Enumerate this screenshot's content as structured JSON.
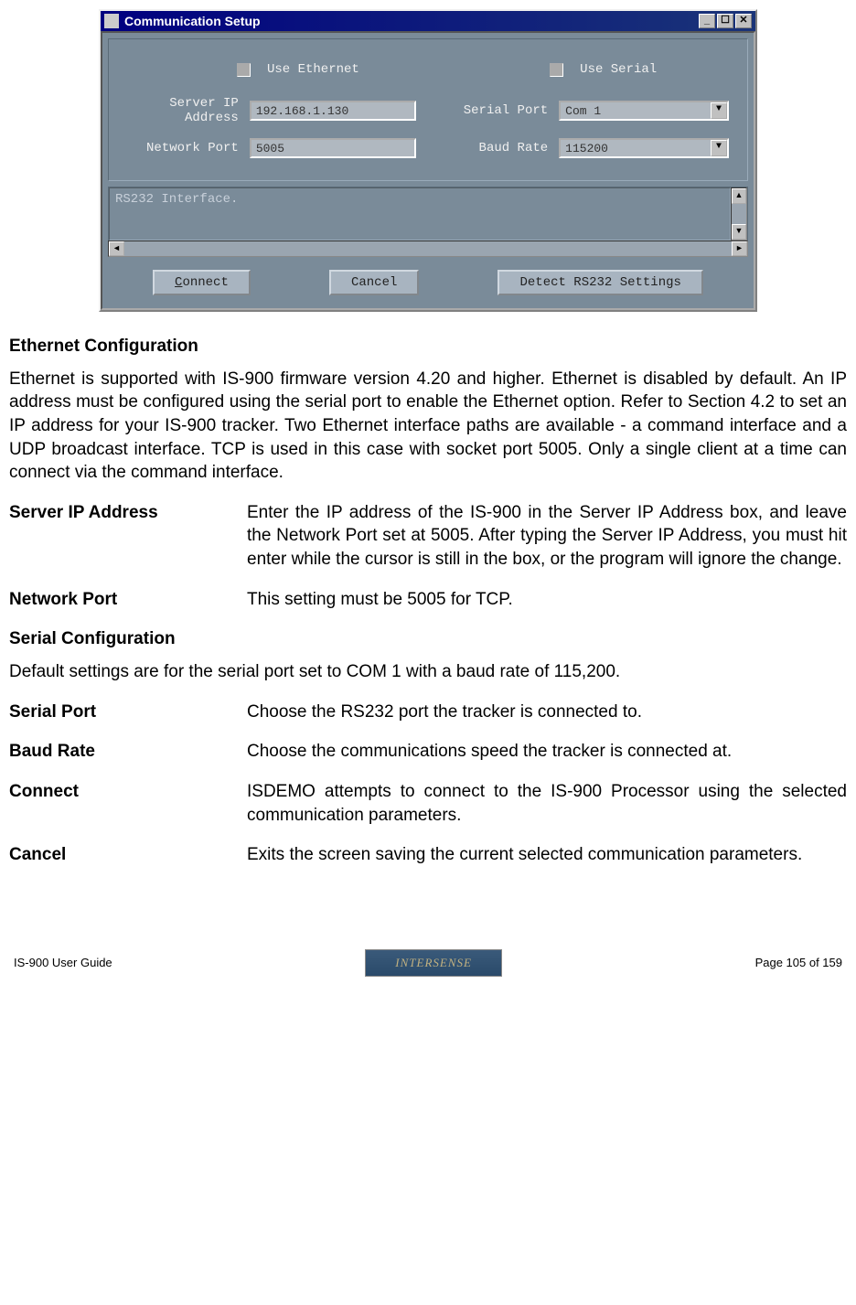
{
  "dialog": {
    "title": "Communication Setup",
    "use_ethernet_label": "Use Ethernet",
    "use_serial_label": "Use Serial",
    "server_ip_label": "Server IP Address",
    "server_ip_value": "192.168.1.130",
    "network_port_label": "Network Port",
    "network_port_value": "5005",
    "serial_port_label": "Serial Port",
    "serial_port_value": "Com 1",
    "baud_rate_label": "Baud Rate",
    "baud_rate_value": "115200",
    "log_text": "RS232 Interface.",
    "connect_btn": "Connect",
    "cancel_btn": "Cancel",
    "detect_btn": "Detect RS232 Settings"
  },
  "doc": {
    "eth_heading": "Ethernet Configuration",
    "eth_para": "Ethernet is supported with IS-900 firmware version 4.20 and higher.  Ethernet is disabled by default.  An IP address must be configured using the serial port to enable the Ethernet option.  Refer to Section 4.2 to set an IP address for your IS-900 tracker.  Two Ethernet interface paths are available - a command interface and a UDP broadcast interface.  TCP is used in this case with socket port 5005.  Only a single client at a time can connect via the command interface.",
    "server_ip_term": "Server IP Address",
    "server_ip_desc": "Enter the IP address of the IS-900 in the Server IP Address box, and leave the Network Port set at 5005.  After typing the Server IP Address, you must hit enter while the cursor is still in the box, or the program will ignore the change.",
    "network_port_term": "Network Port",
    "network_port_desc": "This setting must be 5005 for TCP.",
    "serial_heading": "Serial Configuration",
    "serial_para": "Default settings are for the serial port set to COM 1 with a baud rate of 115,200.",
    "serial_port_term": "Serial Port",
    "serial_port_desc": "Choose the RS232 port the tracker is connected to.",
    "baud_rate_term": "Baud Rate",
    "baud_rate_desc": "Choose the communications speed the tracker is connected at.",
    "connect_term": "Connect",
    "connect_desc": "ISDEMO attempts to connect to the IS-900 Processor using the selected communication parameters.",
    "cancel_term": "Cancel",
    "cancel_desc": "Exits the screen saving the current selected communication parameters."
  },
  "footer": {
    "left": "IS-900 User Guide",
    "right": "Page 105 of 159",
    "logo": "INTERSENSE"
  }
}
